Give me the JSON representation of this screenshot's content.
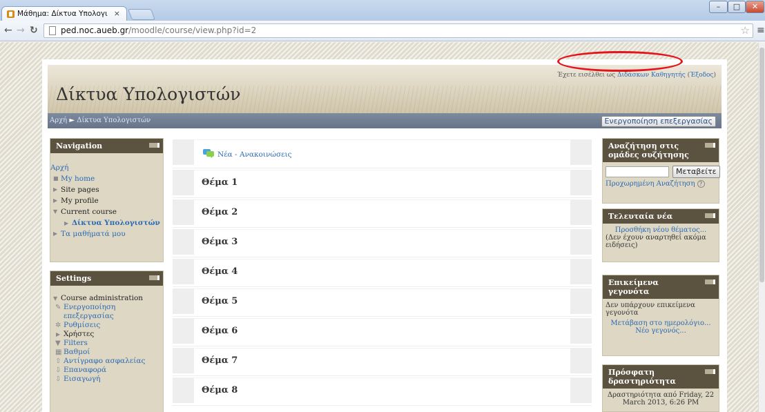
{
  "browser": {
    "tab_title": "Μάθημα: Δίκτυα Υπολογι",
    "tab_close": "×",
    "url_host": "ped.noc.aueb.gr",
    "url_path": "/moodle/course/view.php?id=2"
  },
  "header": {
    "site_title": "Δίκτυα Υπολογιστών",
    "login_prefix": "Έχετε εισέλθει ως ",
    "login_user": "Διδάσκων Καθηγητής",
    "logout_label": "Έξοδος"
  },
  "navbar": {
    "home": "Αρχή",
    "separator": "►",
    "course": "Δίκτυα Υπολογιστών",
    "edit_button": "Ενεργοποίηση επεξεργασίας"
  },
  "navigation": {
    "title": "Navigation",
    "home": "Αρχή",
    "my_home": "My home",
    "site_pages": "Site pages",
    "my_profile": "My profile",
    "current_course": "Current course",
    "course": "Δίκτυα Υπολογιστών",
    "my_courses": "Τα μαθήματά μου"
  },
  "settings": {
    "title": "Settings",
    "course_admin": "Course administration",
    "edit_line1": "Ενεργοποίηση",
    "edit_line2": "επεξεργασίας",
    "settings": "Ρυθμίσεις",
    "users": "Χρήστες",
    "filters": "Filters",
    "grades": "Βαθμοί",
    "backup": "Αντίγραφο ασφαλείας",
    "restore": "Επαναφορά",
    "import": "Εισαγωγή"
  },
  "main": {
    "news_forum": "Νέα - Ανακοινώσεις",
    "topics": [
      "Θέμα 1",
      "Θέμα 2",
      "Θέμα 3",
      "Θέμα 4",
      "Θέμα 5",
      "Θέμα 6",
      "Θέμα 7",
      "Θέμα 8"
    ]
  },
  "search_forums": {
    "title": "Αναζήτηση στις ομάδες συζήτησης",
    "button": "Μεταβείτε",
    "advanced": "Προχωρημένη Αναζήτηση",
    "help": "?"
  },
  "latest_news": {
    "title": "Τελευταία νέα",
    "add_topic": "Προσθήκη νέου θέματος...",
    "empty": "(Δεν έχουν αναρτηθεί ακόμα ειδήσεις)"
  },
  "upcoming_events": {
    "title": "Επικείμενα γεγονότα",
    "empty": "Δεν υπάρχουν επικείμενα γεγονότα",
    "goto_calendar": "Μετάβαση στο ημερολόγιο...",
    "new_event": "Νέο γεγονός..."
  },
  "recent_activity": {
    "title": "Πρόσφατη δραστηριότητα",
    "since": "Δραστηριότητα από Friday, 22 March 2013, 6:26 PM"
  }
}
